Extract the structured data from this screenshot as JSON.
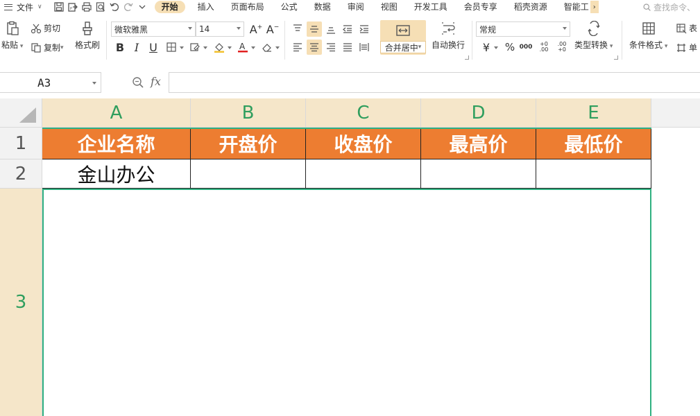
{
  "menubar": {
    "file_label": "文件",
    "tabs": [
      {
        "label": "开始",
        "active": true
      },
      {
        "label": "插入"
      },
      {
        "label": "页面布局"
      },
      {
        "label": "公式"
      },
      {
        "label": "数据"
      },
      {
        "label": "审阅"
      },
      {
        "label": "视图"
      },
      {
        "label": "开发工具"
      },
      {
        "label": "会员专享"
      },
      {
        "label": "稻壳资源"
      },
      {
        "label": "智能工"
      }
    ],
    "search_placeholder": "查找命令、"
  },
  "ribbon": {
    "paste_label": "粘贴",
    "cut_label": "剪切",
    "copy_label": "复制",
    "format_painter_label": "格式刷",
    "font_name": "微软雅黑",
    "font_size": "14",
    "bold": "B",
    "italic": "I",
    "underline": "U",
    "merge_center_label": "合并居中",
    "wrap_text_label": "自动换行",
    "number_format": "常规",
    "currency_symbol": "¥",
    "percent_symbol": "%",
    "thousands_symbol": "000",
    "inc_decimal": "+0 .00",
    "dec_decimal": ".00 +0",
    "type_convert_label": "类型转换",
    "conditional_format_label": "条件格式",
    "table_style_label": "表",
    "cell_label": "单"
  },
  "formula_bar": {
    "name_box": "A3",
    "fx": "fx",
    "formula": ""
  },
  "grid": {
    "columns": [
      "A",
      "B",
      "C",
      "D",
      "E"
    ],
    "rows": [
      "1",
      "2",
      "3"
    ],
    "header_row": [
      "企业名称",
      "开盘价",
      "收盘价",
      "最高价",
      "最低价"
    ],
    "data_row": [
      "金山办公",
      "",
      "",
      "",
      ""
    ],
    "selected_cell": "A3",
    "header_fill_color": "#ed7d31",
    "selection_color": "#2fb080"
  }
}
